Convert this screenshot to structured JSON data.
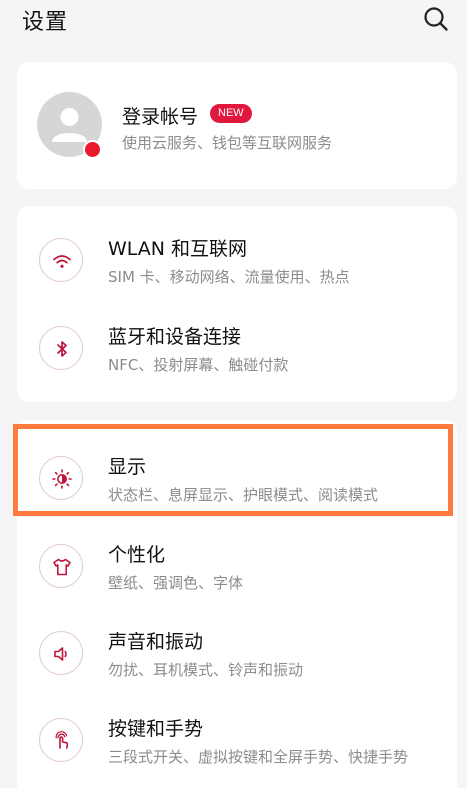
{
  "header": {
    "title": "设置"
  },
  "account": {
    "title": "登录帐号",
    "badge": "NEW",
    "subtitle": "使用云服务、钱包等互联网服务"
  },
  "network_group": {
    "items": [
      {
        "title": "WLAN 和互联网",
        "subtitle": "SIM 卡、移动网络、流量使用、热点"
      },
      {
        "title": "蓝牙和设备连接",
        "subtitle": "NFC、投射屏幕、触碰付款"
      }
    ]
  },
  "display_group": {
    "items": [
      {
        "title": "显示",
        "subtitle": "状态栏、息屏显示、护眼模式、阅读模式"
      },
      {
        "title": "个性化",
        "subtitle": "壁纸、强调色、字体"
      },
      {
        "title": "声音和振动",
        "subtitle": "勿扰、耳机模式、铃声和振动"
      },
      {
        "title": "按键和手势",
        "subtitle": "三段式开关、虚拟按键和全屏手势、快捷手势"
      }
    ]
  },
  "colors": {
    "accent": "#c0143c",
    "highlight_border": "#ff7a3d",
    "avatar_dot": "#e8192c"
  }
}
